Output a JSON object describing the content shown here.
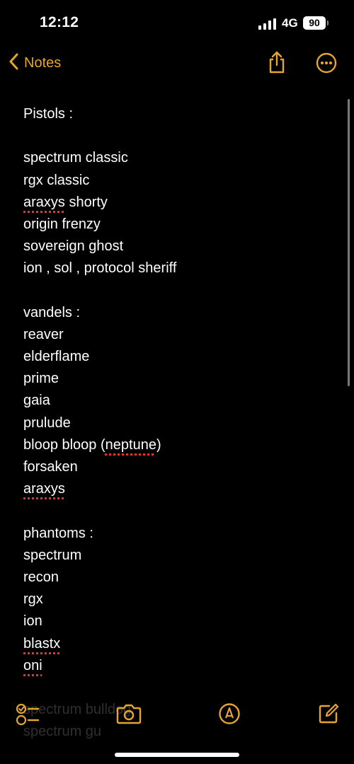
{
  "status_bar": {
    "time": "12:12",
    "network": "4G",
    "battery": "90"
  },
  "nav": {
    "back_label": "Notes"
  },
  "note": {
    "lines": [
      {
        "text": "Pistols :"
      },
      {
        "text": ""
      },
      {
        "text": "spectrum classic"
      },
      {
        "text": "rgx classic"
      },
      {
        "text": "araxys shorty",
        "misspelled": "araxys"
      },
      {
        "text": "origin frenzy"
      },
      {
        "text": "sovereign ghost"
      },
      {
        "text": "ion , sol , protocol sheriff"
      },
      {
        "text": ""
      },
      {
        "text": "vandels :"
      },
      {
        "text": "reaver"
      },
      {
        "text": "elderflame"
      },
      {
        "text": "prime"
      },
      {
        "text": "gaia"
      },
      {
        "text": "prulude"
      },
      {
        "text": "bloop bloop (neptune)",
        "misspelled": "neptune"
      },
      {
        "text": "forsaken"
      },
      {
        "text": "araxys",
        "misspelled": "araxys"
      },
      {
        "text": ""
      },
      {
        "text": "phantoms :"
      },
      {
        "text": "spectrum"
      },
      {
        "text": "recon"
      },
      {
        "text": "rgx"
      },
      {
        "text": "ion"
      },
      {
        "text": "blastx",
        "misspelled": "blastx"
      },
      {
        "text": "oni",
        "misspelled": "oni"
      }
    ],
    "ghost_lines": [
      "spectrum bulldog",
      "spectrum gu"
    ]
  },
  "toolbar": {
    "items": [
      "checklist-icon",
      "camera-icon",
      "markup-icon",
      "compose-icon"
    ]
  },
  "colors": {
    "accent": "#e5a52f",
    "background": "#000000",
    "spellcheck": "#e0342f"
  }
}
